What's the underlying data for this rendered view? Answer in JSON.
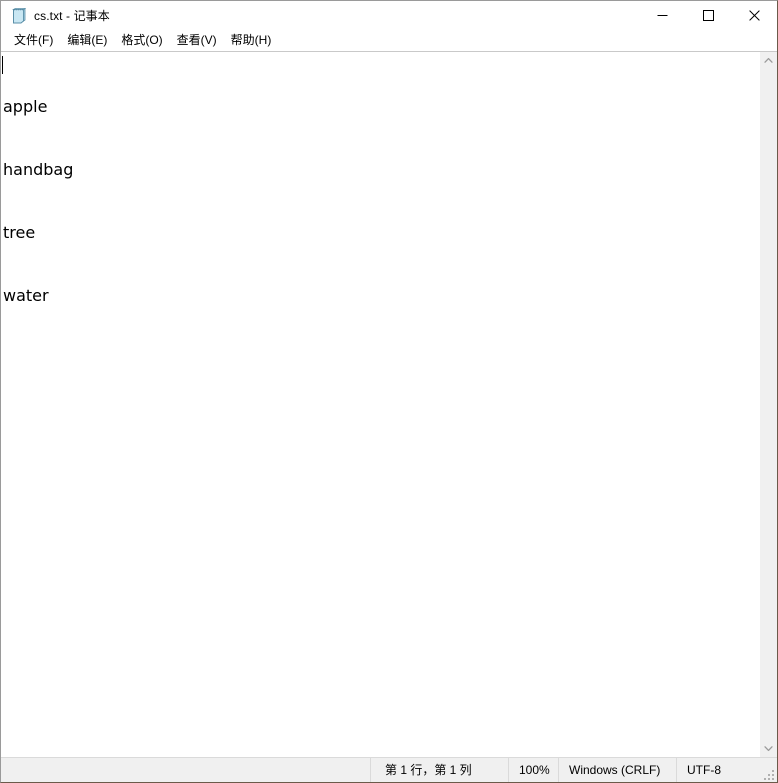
{
  "window": {
    "title": "cs.txt - 记事本",
    "app_icon": "notepad-icon",
    "controls": {
      "minimize_label": "最小化",
      "maximize_label": "最大化",
      "close_label": "关闭"
    }
  },
  "menu": {
    "items": [
      {
        "label": "文件(F)",
        "name": "menu-file"
      },
      {
        "label": "编辑(E)",
        "name": "menu-edit"
      },
      {
        "label": "格式(O)",
        "name": "menu-format"
      },
      {
        "label": "查看(V)",
        "name": "menu-view"
      },
      {
        "label": "帮助(H)",
        "name": "menu-help"
      }
    ]
  },
  "editor": {
    "lines": [
      "apple",
      "handbag",
      "tree",
      "water"
    ],
    "caret_line": 1,
    "caret_column": 1
  },
  "scrollbar": {
    "up_arrow": "chevron-up-icon",
    "down_arrow": "chevron-down-icon"
  },
  "status_bar": {
    "line_col": "第 1 行，第 1 列",
    "zoom": "100%",
    "line_ending": "Windows (CRLF)",
    "encoding": "UTF-8"
  },
  "colors": {
    "window_background": "#ffffff",
    "status_background": "#f0f0f0",
    "divider": "#dadada",
    "text": "#000000",
    "scrollbar_track": "#f0f0f0"
  }
}
